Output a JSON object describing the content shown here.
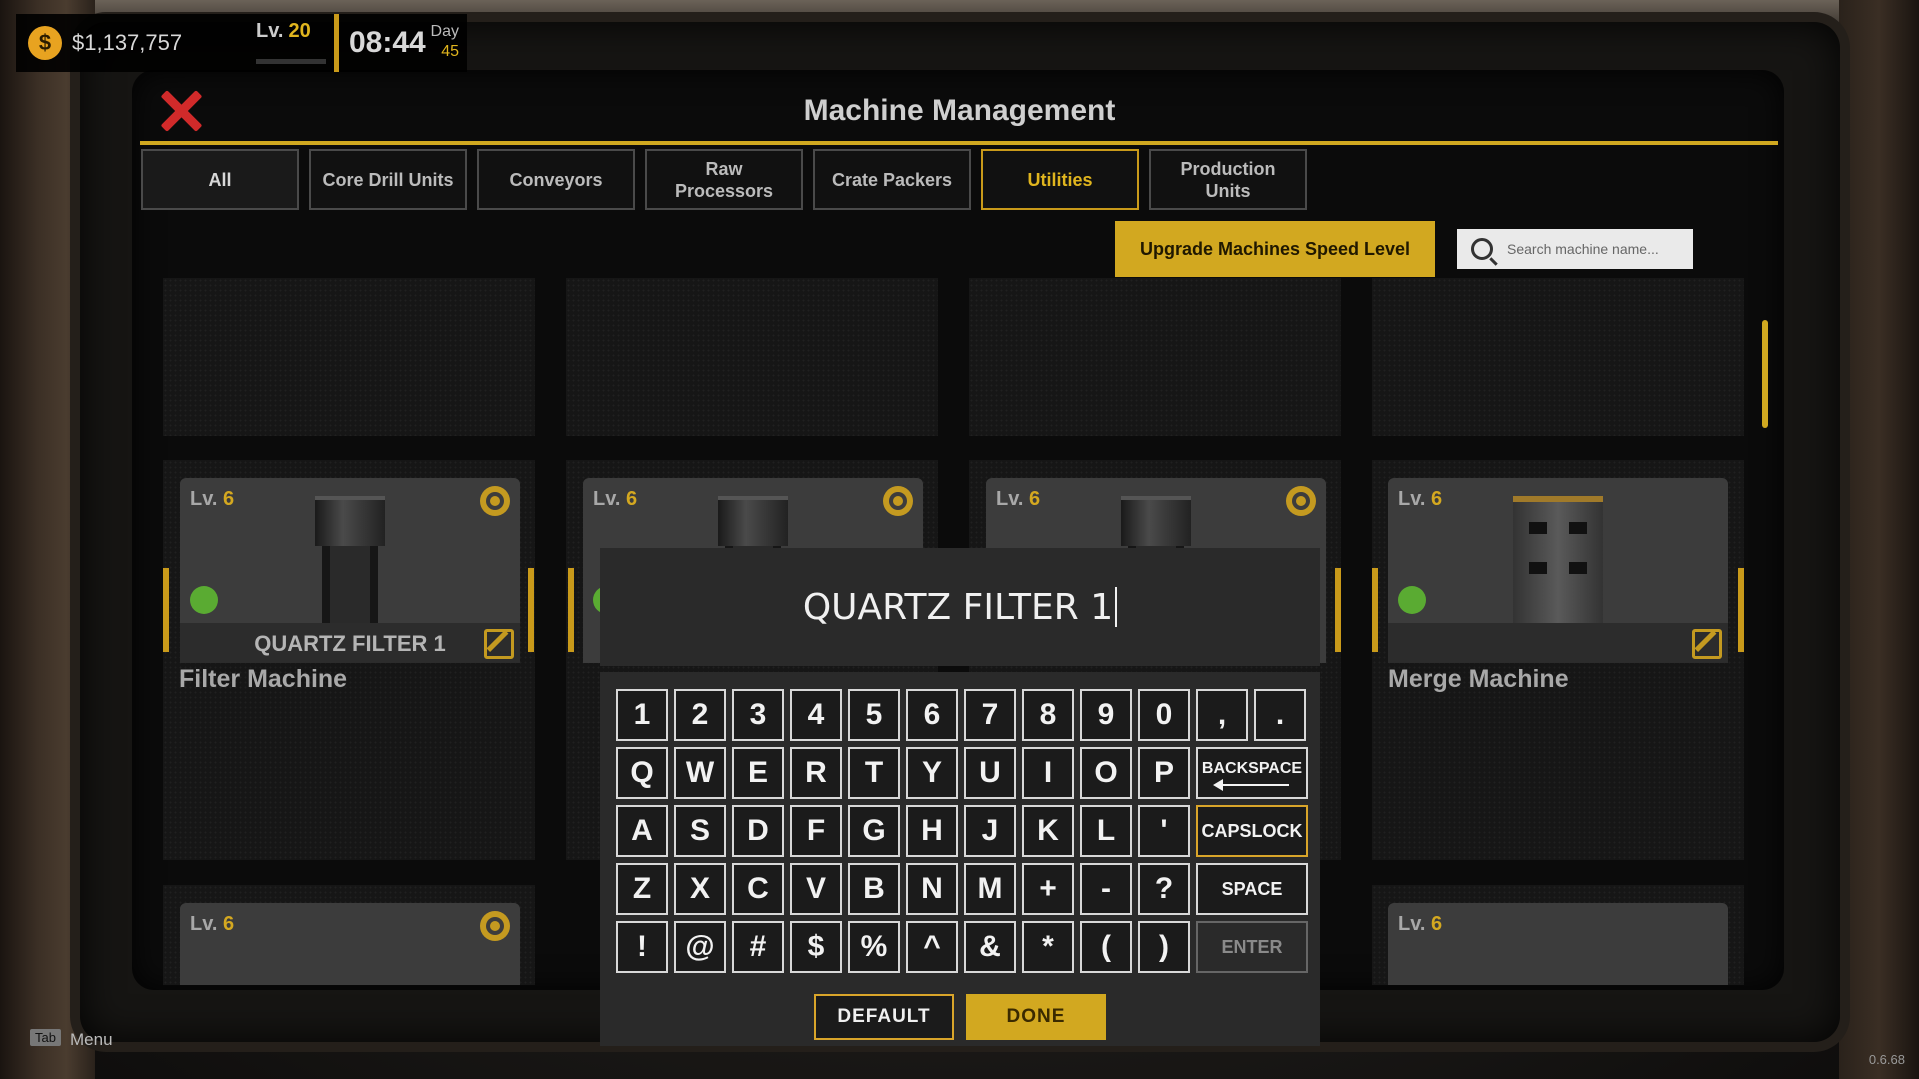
{
  "hud": {
    "money": "$1,137,757",
    "coin_symbol": "$",
    "level_label": "Lv.",
    "level_value": "20",
    "xp_fraction": 0.0,
    "time": "08:44",
    "day_label": "Day",
    "day_value": "45"
  },
  "panel": {
    "title": "Machine Management",
    "tabs": [
      {
        "label": "All"
      },
      {
        "label": "Core Drill Units"
      },
      {
        "label": "Conveyors"
      },
      {
        "label": "Raw Processors"
      },
      {
        "label": "Crate Packers"
      },
      {
        "label": "Utilities"
      },
      {
        "label": "Production Units"
      }
    ],
    "active_tab": "Utilities",
    "upgrade_label": "Upgrade Machines Speed Level",
    "search_placeholder": "Search machine name..."
  },
  "cards": [
    {
      "level_label": "Lv.",
      "level": "6",
      "name": "QUARTZ FILTER 1",
      "type": "Filter Machine",
      "status": "active"
    },
    {
      "level_label": "Lv.",
      "level": "6",
      "name": "",
      "type": "",
      "status": "active"
    },
    {
      "level_label": "Lv.",
      "level": "6",
      "name": "",
      "type": "",
      "status": "active"
    },
    {
      "level_label": "Lv.",
      "level": "6",
      "name": "",
      "type": "Merge Machine",
      "status": "active"
    },
    {
      "level_label": "Lv.",
      "level": "6"
    },
    {
      "level_label": "Lv.",
      "level": "6"
    }
  ],
  "rename": {
    "value": "QUARTZ FILTER 1"
  },
  "keyboard": {
    "row1": [
      "1",
      "2",
      "3",
      "4",
      "5",
      "6",
      "7",
      "8",
      "9",
      "0",
      ",",
      "."
    ],
    "row2": [
      "Q",
      "W",
      "E",
      "R",
      "T",
      "Y",
      "U",
      "I",
      "O",
      "P"
    ],
    "row3": [
      "A",
      "S",
      "D",
      "F",
      "G",
      "H",
      "J",
      "K",
      "L",
      "'"
    ],
    "row4": [
      "Z",
      "X",
      "C",
      "V",
      "B",
      "N",
      "M",
      "+",
      "-",
      "?"
    ],
    "row5": [
      "!",
      "@",
      "#",
      "$",
      "%",
      "^",
      "&",
      "*",
      "(",
      ")"
    ],
    "backspace": "BACKSPACE",
    "capslock": "CAPSLOCK",
    "space": "SPACE",
    "enter": "ENTER",
    "default_label": "DEFAULT",
    "done_label": "DONE"
  },
  "footer": {
    "tab_key": "Tab",
    "menu_label": "Menu",
    "version": "0.6.68"
  },
  "colors": {
    "accent": "#d2a820",
    "close": "#d12a2a",
    "status_active": "#5aab32"
  }
}
